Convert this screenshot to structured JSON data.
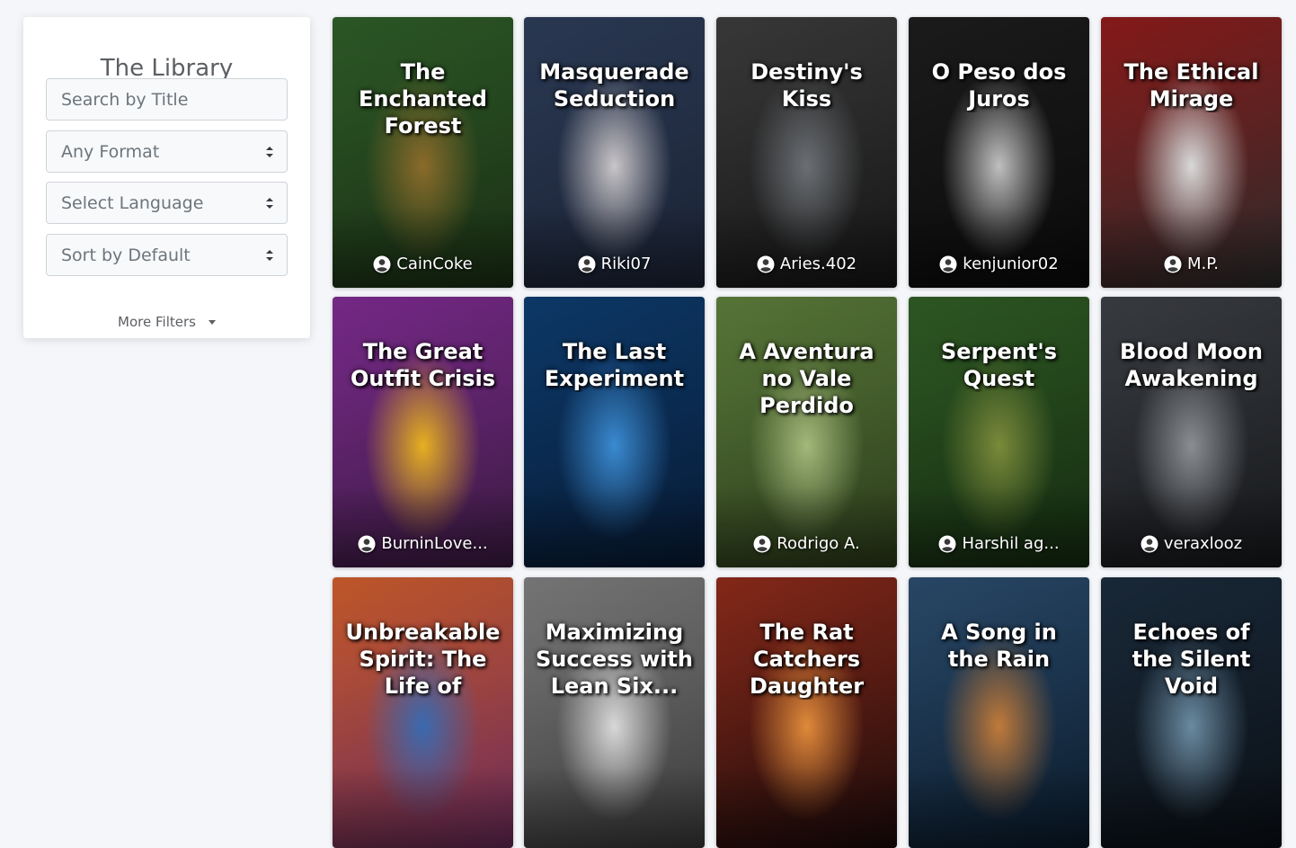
{
  "sidebar": {
    "title": "The Library",
    "search_placeholder": "Search by Title",
    "format_value": "Any Format",
    "language_value": "Select Language",
    "sort_value": "Sort by Default",
    "more_filters_label": "More Filters"
  },
  "books": [
    {
      "title": "The Enchanted Forest",
      "author": "CainCoke",
      "colors": [
        "#2d5a27",
        "#8a6b2a",
        "#1a2e14"
      ]
    },
    {
      "title": "Masquerade Seduction",
      "author": "Riki07",
      "colors": [
        "#2b3a55",
        "#c9c5c8",
        "#1a2233"
      ]
    },
    {
      "title": "Destiny's Kiss",
      "author": "Aries.402",
      "colors": [
        "#3a3a3a",
        "#6b6f74",
        "#151515"
      ]
    },
    {
      "title": "O Peso dos Juros",
      "author": "kenjunior02",
      "colors": [
        "#1c1c1c",
        "#bfbfbf",
        "#0a0a0a"
      ]
    },
    {
      "title": "The Ethical Mirage",
      "author": "M.P.",
      "colors": [
        "#8b1a1a",
        "#d9d9d9",
        "#2a2a2a"
      ]
    },
    {
      "title": "The Great Outfit Crisis",
      "author": "BurninLove...",
      "colors": [
        "#7a2a8c",
        "#e6b020",
        "#3a1a40"
      ]
    },
    {
      "title": "The Last Experiment",
      "author": "",
      "colors": [
        "#0d3a6b",
        "#3a8ad0",
        "#071a33"
      ]
    },
    {
      "title": "A Aventura no Vale Perdido",
      "author": "Rodrigo A.",
      "colors": [
        "#5a7a3a",
        "#a3b87a",
        "#2a3a1a"
      ]
    },
    {
      "title": "Serpent's Quest",
      "author": "Harshil ag...",
      "colors": [
        "#2f5a24",
        "#7a8a3a",
        "#142a10"
      ]
    },
    {
      "title": "Blood Moon Awakening",
      "author": "veraxlooz",
      "colors": [
        "#3a3d42",
        "#8a8d92",
        "#15171a"
      ]
    },
    {
      "title": "Unbreakable Spirit: The Life of Maya...",
      "author": "",
      "colors": [
        "#c85a2a",
        "#3a6ab0",
        "#6a2a5a"
      ]
    },
    {
      "title": "Maximizing Success with Lean Six...",
      "author": "",
      "colors": [
        "#7a7a7a",
        "#d8d8d8",
        "#3a3a3a"
      ]
    },
    {
      "title": "The Rat Catchers Daughter",
      "author": "",
      "colors": [
        "#8a2a1a",
        "#e08a3a",
        "#1a0a0a"
      ]
    },
    {
      "title": "A Song in the Rain",
      "author": "",
      "colors": [
        "#2a4a6a",
        "#c07a3a",
        "#0a1a2a"
      ]
    },
    {
      "title": "Echoes of the Silent Void",
      "author": "",
      "colors": [
        "#1a2a3a",
        "#6a8aa0",
        "#0a0f15"
      ]
    }
  ]
}
